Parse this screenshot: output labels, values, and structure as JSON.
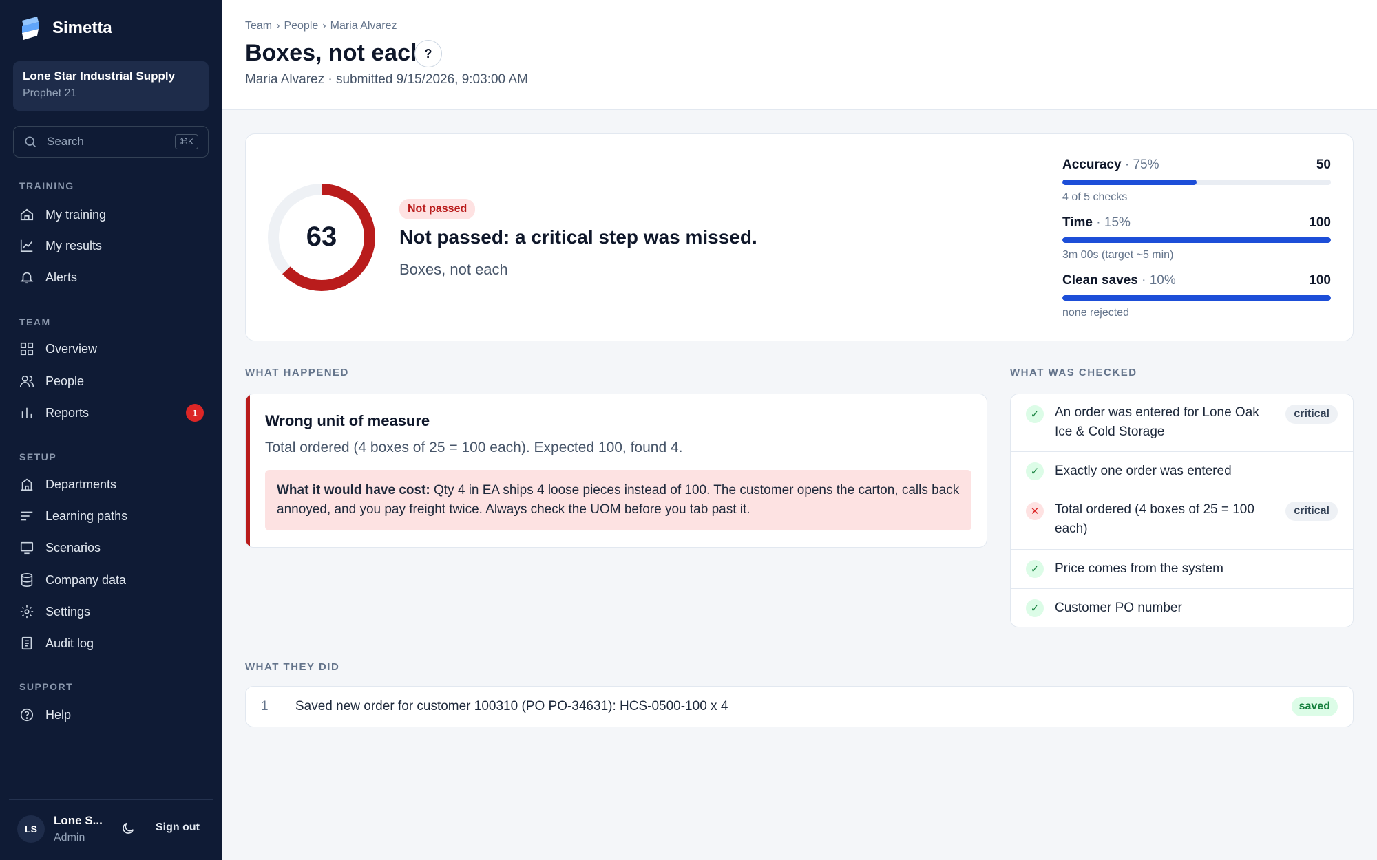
{
  "app": {
    "name": "Simetta"
  },
  "org": {
    "name": "Lone Star Industrial Supply",
    "system": "Prophet 21"
  },
  "search": {
    "placeholder": "Search",
    "shortcut": "⌘K"
  },
  "nav": {
    "training": {
      "label": "TRAINING",
      "items": [
        {
          "label": "My training",
          "icon": "home-icon"
        },
        {
          "label": "My results",
          "icon": "chart-line-icon"
        },
        {
          "label": "Alerts",
          "icon": "bell-icon"
        }
      ]
    },
    "team": {
      "label": "TEAM",
      "items": [
        {
          "label": "Overview",
          "icon": "grid-icon"
        },
        {
          "label": "People",
          "icon": "users-icon"
        },
        {
          "label": "Reports",
          "icon": "bar-chart-icon",
          "badge": "1"
        }
      ]
    },
    "setup": {
      "label": "SETUP",
      "items": [
        {
          "label": "Departments",
          "icon": "building-icon"
        },
        {
          "label": "Learning paths",
          "icon": "list-icon"
        },
        {
          "label": "Scenarios",
          "icon": "monitor-icon"
        },
        {
          "label": "Company data",
          "icon": "database-icon"
        },
        {
          "label": "Settings",
          "icon": "gear-icon"
        },
        {
          "label": "Audit log",
          "icon": "clipboard-icon"
        }
      ]
    },
    "support": {
      "label": "SUPPORT",
      "items": [
        {
          "label": "Help",
          "icon": "help-icon"
        }
      ]
    }
  },
  "user": {
    "initials": "LS",
    "name": "Lone S...",
    "role": "Admin",
    "signout": "Sign out"
  },
  "breadcrumb": {
    "team": "Team",
    "people": "People",
    "person": "Maria Alvarez",
    "sep": "›"
  },
  "page": {
    "title": "Boxes, not each",
    "help": "?",
    "subtitle": "Maria Alvarez · submitted 9/15/2026, 9:03:00 AM"
  },
  "score": {
    "value": "63",
    "fraction": 0.63,
    "status": "Not passed",
    "headline": "Not passed: a critical step was missed.",
    "scenario": "Boxes, not each",
    "ring_color": "#b91c1c"
  },
  "metrics": [
    {
      "name": "Accuracy",
      "weight": " · 75%",
      "score": "50",
      "fill": 0.5,
      "note": "4 of 5 checks"
    },
    {
      "name": "Time",
      "weight": " · 15%",
      "score": "100",
      "fill": 1.0,
      "note": "3m 00s (target ~5 min)"
    },
    {
      "name": "Clean saves",
      "weight": " · 10%",
      "score": "100",
      "fill": 1.0,
      "note": "none rejected"
    }
  ],
  "happened": {
    "label": "WHAT HAPPENED",
    "title": "Wrong unit of measure",
    "desc": "Total ordered (4 boxes of 25 = 100 each). Expected 100, found 4.",
    "cost_label": "What it would have cost:",
    "cost_text": " Qty 4 in EA ships 4 loose pieces instead of 100. The customer opens the carton, calls back annoyed, and you pay freight twice. Always check the UOM before you tab past it."
  },
  "checked": {
    "label": "WHAT WAS CHECKED",
    "items": [
      {
        "text": "An order was entered for Lone Oak Ice & Cold Storage",
        "status": "pass",
        "critical": "critical"
      },
      {
        "text": "Exactly one order was entered",
        "status": "pass",
        "critical": ""
      },
      {
        "text": "Total ordered (4 boxes of 25 = 100 each)",
        "status": "fail",
        "critical": "critical"
      },
      {
        "text": "Price comes from the system",
        "status": "pass",
        "critical": ""
      },
      {
        "text": "Customer PO number",
        "status": "pass",
        "critical": ""
      }
    ]
  },
  "did": {
    "label": "WHAT THEY DID",
    "items": [
      {
        "num": "1",
        "text": "Saved new order for customer 100310 (PO PO-34631): HCS-0500-100 x 4",
        "status": "saved"
      }
    ]
  },
  "colors": {
    "sidebar": "#0f1b35",
    "accent": "#1d4ed8",
    "danger": "#b91c1c",
    "success": "#15803d"
  }
}
